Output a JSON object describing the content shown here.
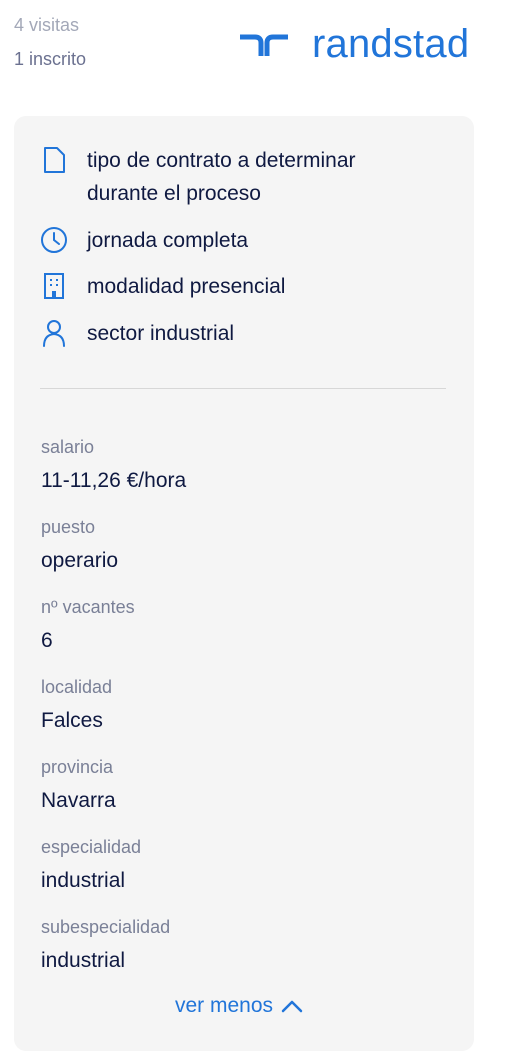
{
  "stats": {
    "visits": "4 visitas",
    "enrolled": "1 inscrito"
  },
  "logo": {
    "word": "randstad",
    "color": "#2175d9"
  },
  "features": [
    {
      "icon": "document-icon",
      "line1": "tipo de contrato a determinar",
      "line2": "durante el proceso"
    },
    {
      "icon": "clock-icon",
      "text": "jornada completa"
    },
    {
      "icon": "building-icon",
      "text": "modalidad presencial"
    },
    {
      "icon": "person-icon",
      "text": "sector industrial"
    }
  ],
  "details": [
    {
      "label": "salario",
      "value": "11-11,26 €/hora"
    },
    {
      "label": "puesto",
      "value": "operario"
    },
    {
      "label": "nº vacantes",
      "value": "6"
    },
    {
      "label": "localidad",
      "value": "Falces"
    },
    {
      "label": "provincia",
      "value": "Navarra"
    },
    {
      "label": "especialidad",
      "value": "industrial"
    },
    {
      "label": "subespecialidad",
      "value": "industrial"
    }
  ],
  "toggle": {
    "label": "ver menos",
    "icon": "chevron-up-icon"
  }
}
